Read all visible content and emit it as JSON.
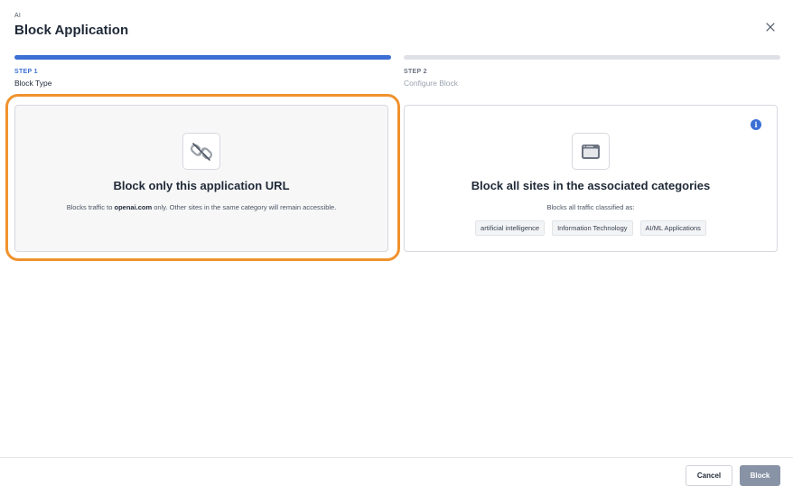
{
  "header": {
    "eyebrow": "AI",
    "title": "Block Application",
    "close_icon": "close-icon"
  },
  "steps": [
    {
      "number": "STEP 1",
      "label": "Block Type",
      "active": true
    },
    {
      "number": "STEP 2",
      "label": "Configure Block",
      "active": false
    }
  ],
  "options": {
    "url_only": {
      "icon": "unlink-icon",
      "title": "Block only this application URL",
      "desc_prefix": "Blocks traffic to ",
      "desc_domain": "openai.com",
      "desc_suffix": " only. Other sites in the same category will remain accessible.",
      "selected": true
    },
    "categories": {
      "icon": "browser-window-icon",
      "title": "Block all sites in the associated categories",
      "desc": "Blocks all traffic classified as:",
      "info_icon": "info-icon",
      "tags": [
        "artificial intelligence",
        "Information Technology",
        "AI/ML Applications"
      ]
    }
  },
  "footer": {
    "cancel_label": "Cancel",
    "block_label": "Block"
  },
  "colors": {
    "accent": "#3b6fd4",
    "highlight": "#f0922e",
    "disabled_button": "#8893a6"
  }
}
